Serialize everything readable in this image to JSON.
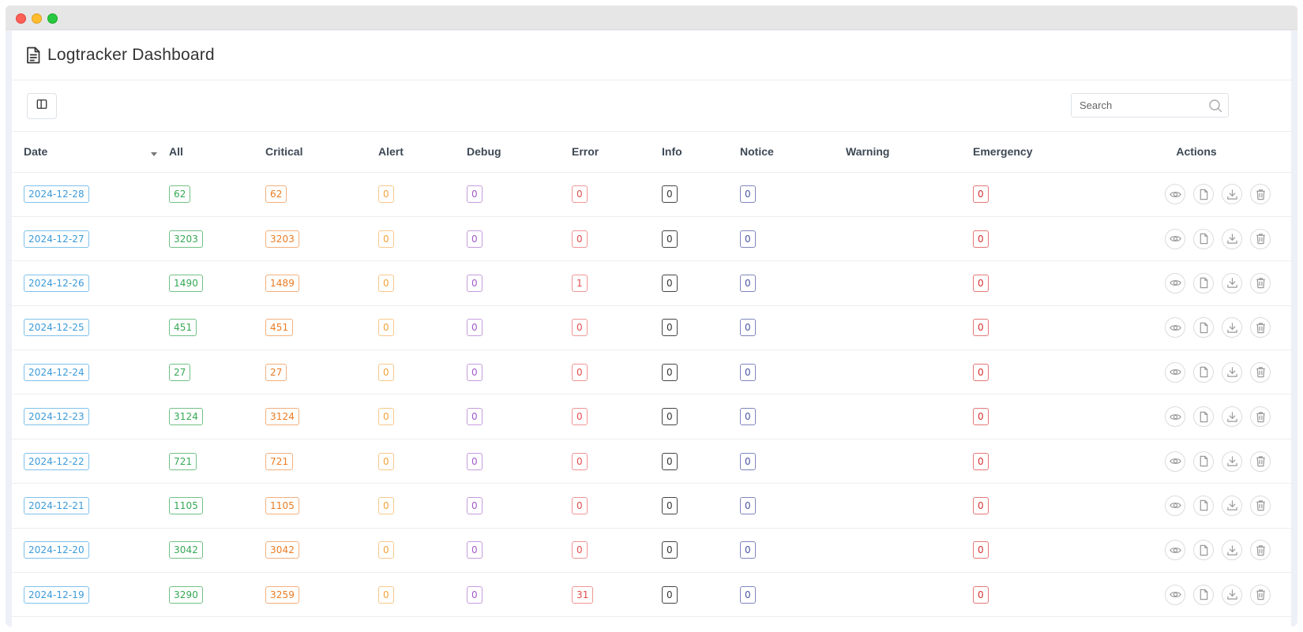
{
  "header": {
    "title": "Logtracker Dashboard"
  },
  "toolbar": {
    "search_placeholder": "Search"
  },
  "table": {
    "columns": {
      "date": "Date",
      "all": "All",
      "critical": "Critical",
      "alert": "Alert",
      "debug": "Debug",
      "error": "Error",
      "info": "Info",
      "notice": "Notice",
      "warning": "Warning",
      "emergency": "Emergency",
      "actions": "Actions"
    },
    "sort": {
      "column": "date",
      "direction": "desc"
    },
    "rows": [
      {
        "date": "2024-12-28",
        "all": "62",
        "critical": "62",
        "alert": "0",
        "debug": "0",
        "error": "0",
        "info": "0",
        "notice": "0",
        "emergency": "0"
      },
      {
        "date": "2024-12-27",
        "all": "3203",
        "critical": "3203",
        "alert": "0",
        "debug": "0",
        "error": "0",
        "info": "0",
        "notice": "0",
        "emergency": "0"
      },
      {
        "date": "2024-12-26",
        "all": "1490",
        "critical": "1489",
        "alert": "0",
        "debug": "0",
        "error": "1",
        "info": "0",
        "notice": "0",
        "emergency": "0"
      },
      {
        "date": "2024-12-25",
        "all": "451",
        "critical": "451",
        "alert": "0",
        "debug": "0",
        "error": "0",
        "info": "0",
        "notice": "0",
        "emergency": "0"
      },
      {
        "date": "2024-12-24",
        "all": "27",
        "critical": "27",
        "alert": "0",
        "debug": "0",
        "error": "0",
        "info": "0",
        "notice": "0",
        "emergency": "0"
      },
      {
        "date": "2024-12-23",
        "all": "3124",
        "critical": "3124",
        "alert": "0",
        "debug": "0",
        "error": "0",
        "info": "0",
        "notice": "0",
        "emergency": "0"
      },
      {
        "date": "2024-12-22",
        "all": "721",
        "critical": "721",
        "alert": "0",
        "debug": "0",
        "error": "0",
        "info": "0",
        "notice": "0",
        "emergency": "0"
      },
      {
        "date": "2024-12-21",
        "all": "1105",
        "critical": "1105",
        "alert": "0",
        "debug": "0",
        "error": "0",
        "info": "0",
        "notice": "0",
        "emergency": "0"
      },
      {
        "date": "2024-12-20",
        "all": "3042",
        "critical": "3042",
        "alert": "0",
        "debug": "0",
        "error": "0",
        "info": "0",
        "notice": "0",
        "emergency": "0"
      },
      {
        "date": "2024-12-19",
        "all": "3290",
        "critical": "3259",
        "alert": "0",
        "debug": "0",
        "error": "31",
        "info": "0",
        "notice": "0",
        "emergency": "0"
      }
    ]
  },
  "icons": {
    "header": "document-icon",
    "toggle": "columns-icon",
    "search": "search-icon",
    "actions": [
      "eye-icon",
      "file-icon",
      "download-icon",
      "trash-icon"
    ]
  },
  "colors": {
    "date": "#3b9ad9",
    "all": "#34a853",
    "critical": "#ea7b22",
    "alert": "#f0a23a",
    "debug": "#a05bc8",
    "error": "#e34b4b",
    "info": "#333333",
    "notice": "#4a55a0",
    "emergency": "#d72e2e"
  }
}
